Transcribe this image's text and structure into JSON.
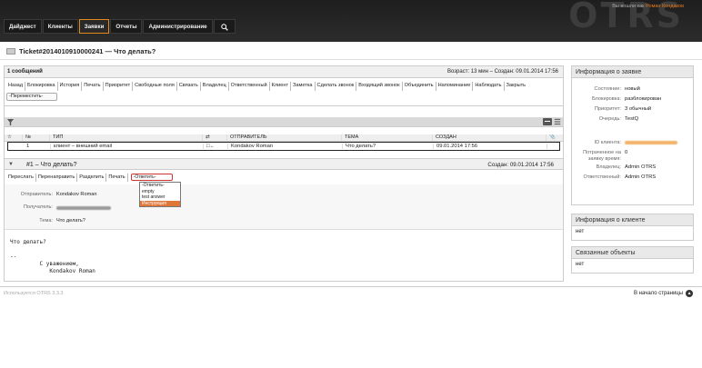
{
  "header": {
    "login_prefix": "Вы вошли как",
    "login_user": "Роман Кондаков",
    "logo": "OTRS",
    "nav": [
      "Дайджест",
      "Клиенты",
      "Заявки",
      "Отчеты",
      "Администрирование"
    ],
    "search_icon": "search-icon"
  },
  "ticket": {
    "title": "Ticket#2014010910000241 — Что делать?"
  },
  "messages": {
    "count": "1 сообщений",
    "age": "Возраст: 13 мин – Создан: 09.01.2014 17:56"
  },
  "actions": [
    "Назад",
    "Блокировка",
    "История",
    "Печать",
    "Приоритет",
    "Свободные поля",
    "Связать",
    "Владелец",
    "Ответственный",
    "Клиент",
    "Заметка",
    "Сделать звонок",
    "Входящий звонок",
    "Объединить",
    "Напоминание",
    "Наблюдать",
    "Закрыть"
  ],
  "move_select": "-Переместить-",
  "article_table": {
    "headers": [
      "№",
      "ТИП",
      "",
      "ОТПРАВИТЕЛЬ",
      "ТЕМА",
      "СОЗДАН"
    ],
    "row": {
      "num": "1",
      "type": "клиент – внешний email",
      "sender": "Kondakov Roman",
      "subject": "Что делать?",
      "created": "09.01.2014 17:56"
    }
  },
  "article": {
    "name": "#1 – Что делать?",
    "created": "Создан: 09.01.2014 17:56",
    "actions": [
      "Переслать",
      "Перенаправить",
      "Разделить",
      "Печать"
    ],
    "reply_select": "-Ответить-",
    "reply_options": [
      "-Ответить-",
      "empty",
      "test answer",
      "Инструкция"
    ],
    "fields": {
      "from_label": "Отправитель:",
      "from_value": "Kondakov Roman",
      "to_label": "Получатель:",
      "subject_label": "Тема:",
      "subject_value": "Что делать?"
    },
    "body": "Что делать?\n\n--\n         С уважением,\n            Kondakov Roman"
  },
  "sidebar": {
    "ticket_info": {
      "title": "Информация о заявке",
      "rows": [
        {
          "label": "Состояние:",
          "value": "новый"
        },
        {
          "label": "Блокировка:",
          "value": "разблокирован"
        },
        {
          "label": "Приоритет:",
          "value": "3 обычный"
        },
        {
          "label": "Очередь:",
          "value": "TestQ"
        }
      ],
      "client_id_label": "ID клиента:",
      "time_label": "Потраченное на заявку время:",
      "time_value": "0",
      "owner_label": "Владелец:",
      "owner_value": "Admin OTRS",
      "responsible_label": "Ответственный:",
      "responsible_value": "Admin OTRS"
    },
    "customer_info": {
      "title": "Информация о клиенте",
      "value": "нет"
    },
    "linked": {
      "title": "Связанные объекты",
      "value": "нет"
    }
  },
  "footer": {
    "powered": "Используется OTRS 3.3.3",
    "top_link": "В начало страницы"
  },
  "colors": {
    "accent": "#e08a1e",
    "header_bg": "#242424"
  }
}
